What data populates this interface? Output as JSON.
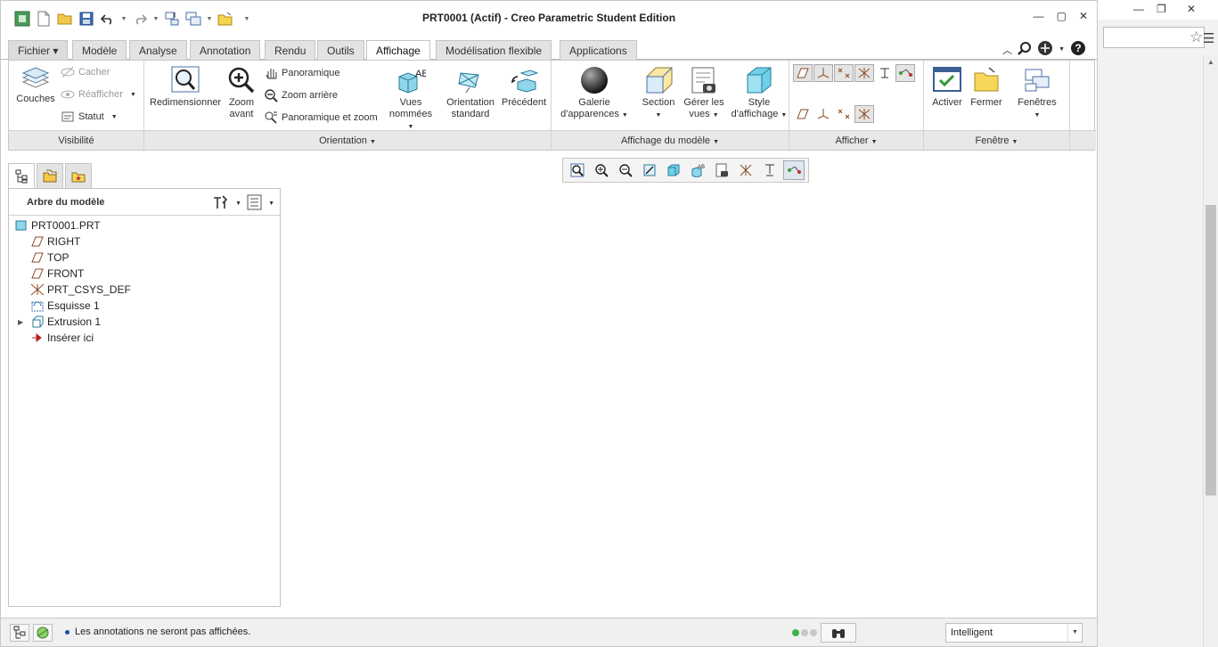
{
  "browser": {
    "minimize": "—",
    "restore": "❐",
    "close": "✕",
    "star_icon": "star-icon",
    "menu_icon": "menu-icon"
  },
  "window": {
    "title": "PRT0001 (Actif) - Creo Parametric Student Edition",
    "controls": {
      "minimize": "—",
      "maximize": "▢",
      "close": "✕"
    }
  },
  "tabs": [
    {
      "label": "Fichier ▾"
    },
    {
      "label": "Modèle"
    },
    {
      "label": "Analyse"
    },
    {
      "label": "Annotation"
    },
    {
      "label": "Rendu"
    },
    {
      "label": "Outils"
    },
    {
      "label": "Affichage",
      "active": true
    },
    {
      "label": "Modélisation flexible"
    },
    {
      "label": "Applications"
    }
  ],
  "ribbon": {
    "visibilite": {
      "label": "Visibilité",
      "couches": "Couches",
      "cacher": "Cacher",
      "reafficher": "Réafficher",
      "statut": "Statut"
    },
    "orientation": {
      "label": "Orientation",
      "redimensionner": "Redimensionner",
      "zoom_avant_1": "Zoom",
      "zoom_avant_2": "avant",
      "panoramique": "Panoramique",
      "zoom_arriere": "Zoom arrière",
      "panoramique_zoom": "Panoramique et zoom",
      "vues_nommees_1": "Vues",
      "vues_nommees_2": "nommées",
      "orientation_std_1": "Orientation",
      "orientation_std_2": "standard",
      "precedent": "Précédent"
    },
    "affichage_modele": {
      "label": "Affichage du modèle",
      "galerie_1": "Galerie",
      "galerie_2": "d'apparences",
      "section": "Section",
      "gerer_vues_1": "Gérer les",
      "gerer_vues_2": "vues",
      "style_1": "Style",
      "style_2": "d'affichage"
    },
    "afficher": {
      "label": "Afficher"
    },
    "fenetre": {
      "label": "Fenêtre",
      "activer": "Activer",
      "fermer": "Fermer",
      "fenetres": "Fenêtres"
    }
  },
  "model_tree": {
    "title": "Arbre du modèle",
    "items": [
      {
        "label": "PRT0001.PRT",
        "icon": "part-icon"
      },
      {
        "label": "RIGHT",
        "icon": "datum-plane-icon"
      },
      {
        "label": "TOP",
        "icon": "datum-plane-icon"
      },
      {
        "label": "FRONT",
        "icon": "datum-plane-icon"
      },
      {
        "label": "PRT_CSYS_DEF",
        "icon": "csys-icon"
      },
      {
        "label": "Esquisse 1",
        "icon": "sketch-icon"
      },
      {
        "label": "Extrusion 1",
        "icon": "extrude-icon",
        "expandable": true
      },
      {
        "label": "Insérer ici",
        "icon": "insert-arrow-icon"
      }
    ]
  },
  "status": {
    "message": "Les annotations ne seront pas affichées.",
    "filter": "Intelligent",
    "colors": {
      "light_on": "#3cb44b",
      "light_off": "#c8c8c8"
    }
  }
}
